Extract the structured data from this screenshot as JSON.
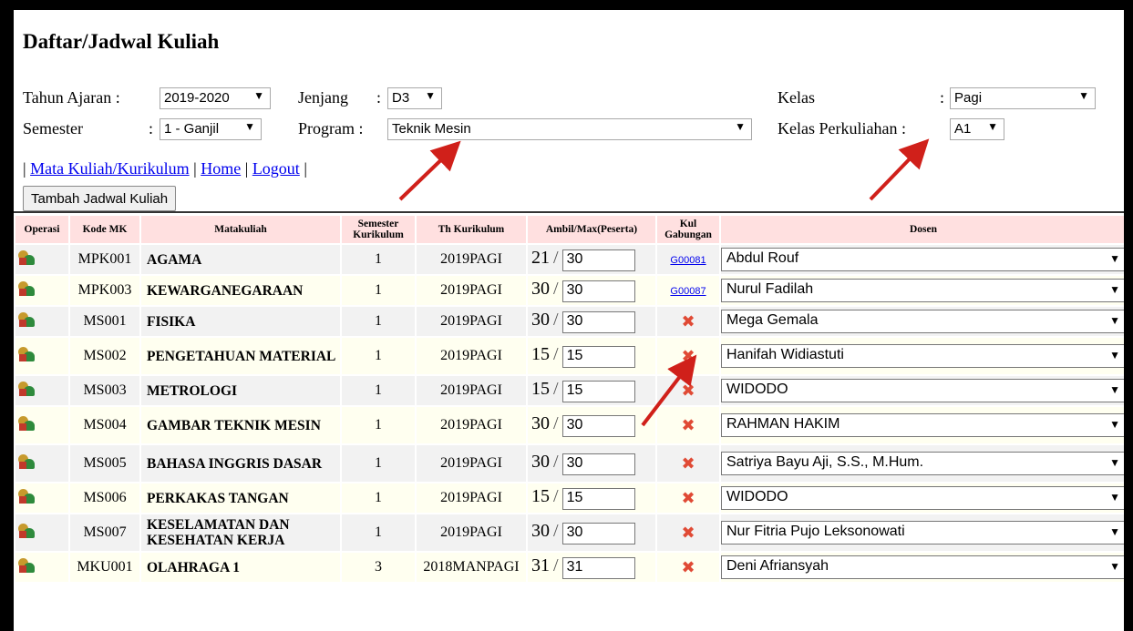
{
  "page": {
    "title": "Daftar/Jadwal Kuliah"
  },
  "filters": {
    "tahun_ajaran_label": "Tahun Ajaran :",
    "tahun_ajaran_value": "2019-2020",
    "jenjang_label": "Jenjang",
    "jenjang_colon": ":",
    "jenjang_value": "D3",
    "kelas_label": "Kelas",
    "kelas_colon": ":",
    "kelas_value": "Pagi",
    "semester_label": "Semester",
    "semester_colon": ":",
    "semester_value": "1 - Ganjil",
    "program_label": "Program :",
    "program_value": "Teknik Mesin",
    "kelas_perkuliahan_label": "Kelas Perkuliahan :",
    "kelas_perkuliahan_value": "A1"
  },
  "nav": {
    "sep": "|",
    "mata_kuliah": "Mata Kuliah/Kurikulum",
    "home": "Home",
    "logout": "Logout"
  },
  "add_button": "Tambah Jadwal Kuliah",
  "columns": {
    "operasi": "Operasi",
    "kode_mk": "Kode MK",
    "matakuliah": "Matakuliah",
    "semester_1": "Semester",
    "semester_2": "Kurikulum",
    "th_kurikulum": "Th Kurikulum",
    "ambil_max": "Ambil/Max(Peserta)",
    "kul_1": "Kul",
    "kul_2": "Gabungan",
    "dosen": "Dosen"
  },
  "slash": "/",
  "rows": [
    {
      "kode": "MPK001",
      "mk": "AGAMA",
      "sem": "1",
      "th": "2019PAGI",
      "ambil": "21",
      "max": "30",
      "gab": "G00081",
      "dosen": "Abdul Rouf"
    },
    {
      "kode": "MPK003",
      "mk": "KEWARGANEGARAAN",
      "sem": "1",
      "th": "2019PAGI",
      "ambil": "30",
      "max": "30",
      "gab": "G00087",
      "dosen": "Nurul Fadilah"
    },
    {
      "kode": "MS001",
      "mk": "FISIKA",
      "sem": "1",
      "th": "2019PAGI",
      "ambil": "30",
      "max": "30",
      "gab": "",
      "dosen": "Mega Gemala"
    },
    {
      "kode": "MS002",
      "mk": "PENGETAHUAN MATERIAL",
      "sem": "1",
      "th": "2019PAGI",
      "ambil": "15",
      "max": "15",
      "gab": "",
      "dosen": "Hanifah Widiastuti"
    },
    {
      "kode": "MS003",
      "mk": "METROLOGI",
      "sem": "1",
      "th": "2019PAGI",
      "ambil": "15",
      "max": "15",
      "gab": "",
      "dosen": "WIDODO"
    },
    {
      "kode": "MS004",
      "mk": "GAMBAR TEKNIK MESIN",
      "sem": "1",
      "th": "2019PAGI",
      "ambil": "30",
      "max": "30",
      "gab": "",
      "dosen": "RAHMAN HAKIM"
    },
    {
      "kode": "MS005",
      "mk": "BAHASA INGGRIS DASAR",
      "sem": "1",
      "th": "2019PAGI",
      "ambil": "30",
      "max": "30",
      "gab": "",
      "dosen": "Satriya Bayu Aji, S.S., M.Hum."
    },
    {
      "kode": "MS006",
      "mk": "PERKAKAS TANGAN",
      "sem": "1",
      "th": "2019PAGI",
      "ambil": "15",
      "max": "15",
      "gab": "",
      "dosen": "WIDODO"
    },
    {
      "kode": "MS007",
      "mk": "KESELAMATAN DAN KESEHATAN KERJA",
      "sem": "1",
      "th": "2019PAGI",
      "ambil": "30",
      "max": "30",
      "gab": "",
      "dosen": "Nur Fitria Pujo Leksonowati"
    },
    {
      "kode": "MKU001",
      "mk": "OLAHRAGA 1",
      "sem": "3",
      "th": "2018MANPAGI",
      "ambil": "31",
      "max": "31",
      "gab": "",
      "dosen": "Deni Afriansyah"
    }
  ],
  "icons": {
    "operasi": "users-edit-icon",
    "no_gabungan": "cross-icon",
    "dropdown": "chevron-down-icon"
  },
  "colors": {
    "header_bg": "#ffe0e0",
    "link": "#0000ee",
    "cross": "#e04a35",
    "annotation_arrow": "#d0201a"
  }
}
